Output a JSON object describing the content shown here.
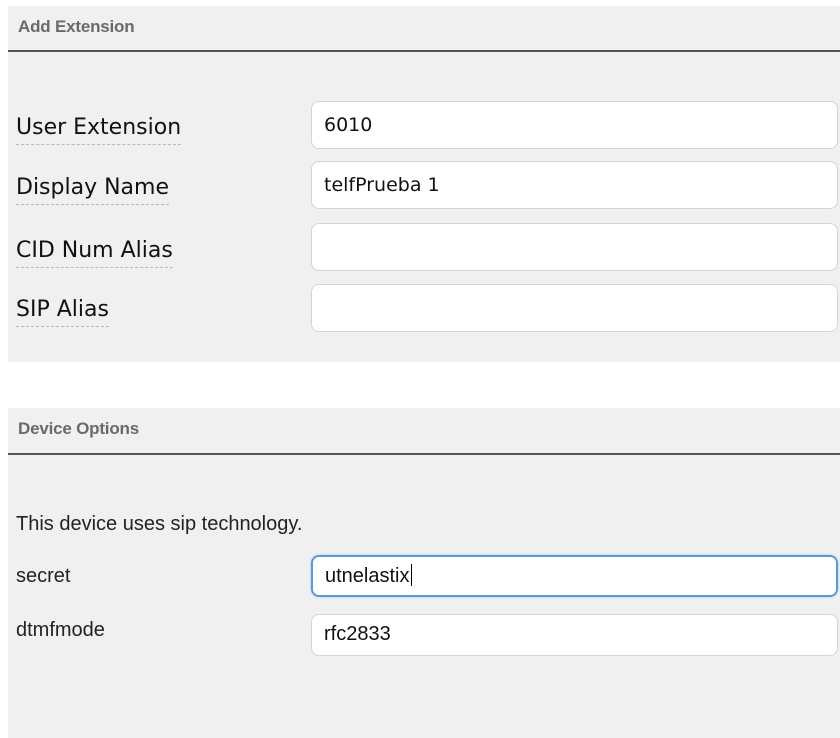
{
  "add_extension": {
    "title": "Add Extension",
    "fields": [
      {
        "label": "User Extension",
        "value": "6010",
        "placeholder": ""
      },
      {
        "label": "Display Name",
        "value": "telfPrueba 1",
        "placeholder": ""
      },
      {
        "label": "CID Num Alias",
        "value": "",
        "placeholder": ""
      },
      {
        "label": "SIP Alias",
        "value": "",
        "placeholder": ""
      }
    ]
  },
  "device_options": {
    "title": "Device Options",
    "note": "This device uses sip technology.",
    "fields": [
      {
        "label": "secret",
        "value": "utnelastix",
        "focused": true
      },
      {
        "label": "dtmfmode",
        "value": "rfc2833",
        "focused": false
      }
    ]
  },
  "colors": {
    "panel_bg": "#f0f0f0",
    "title_text": "#6a6a6a",
    "rule": "#555555",
    "focus_border": "#5b9bd5"
  }
}
